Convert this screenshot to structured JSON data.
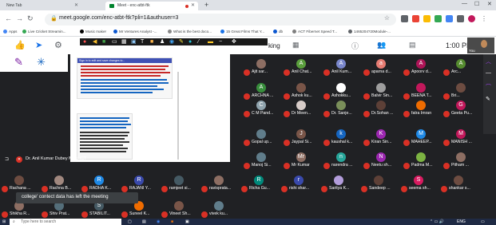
{
  "browser": {
    "tabs": [
      {
        "label": "New Tab",
        "active": false
      },
      {
        "label": "Meet - enc-atbt-ftk",
        "active": true
      }
    ],
    "url": "meet.google.com/enc-atbt-ftk?pli=1&authuser=3",
    "bookmarks": [
      {
        "label": "Apps",
        "color": "#4285f4"
      },
      {
        "label": "Live Cricket Streamin...",
        "color": "#34a853"
      },
      {
        "label": "Music maker",
        "color": "#000000"
      },
      {
        "label": "Mr Ventures Analyst -...",
        "color": "#0b57d0"
      },
      {
        "label": "What is the best doco...",
        "color": "#888888"
      },
      {
        "label": "15 Great Films That Y...",
        "color": "#1a73e8"
      },
      {
        "label": "db",
        "color": "#0b57d0"
      },
      {
        "label": "ACT Fibernet Speed T...",
        "color": "#7f7f7f"
      },
      {
        "label": "1465204?20Module-...",
        "color": "#5f6368"
      }
    ]
  },
  "meet": {
    "title_fragment": "king",
    "clock": "1:00 PM",
    "you_label": "You",
    "presenter": "Dr. Anil Kumar Dubey Multi-ICT",
    "notification": "college' contect data has left the meeting",
    "share": {
      "header": "Sign in to edit and save changes to...",
      "colors": {
        "header": "#3f51b5",
        "text_red": "#c62828",
        "text_blue": "#1565c0"
      }
    },
    "participants": [
      {
        "name": "Ajit sar...",
        "initial": "",
        "color": "#8d6e63"
      },
      {
        "name": "Anil Chat...",
        "initial": "A",
        "color": "#5a9e3c"
      },
      {
        "name": "Anil Kum...",
        "initial": "A",
        "color": "#7986cb"
      },
      {
        "name": "aparna d...",
        "initial": "a",
        "color": "#e67c73"
      },
      {
        "name": "Apoorv d...",
        "initial": "A",
        "color": "#ad1457"
      },
      {
        "name": "Arc...",
        "initial": "A",
        "color": "#558b2f"
      },
      {
        "name": "ARCHNA ...",
        "initial": "A",
        "color": "#388e3c"
      },
      {
        "name": "Ashok ku...",
        "initial": "",
        "color": "#795548"
      },
      {
        "name": "Ashokku...",
        "initial": "",
        "color": "#ffffff"
      },
      {
        "name": "Balvir Sin...",
        "initial": "",
        "color": "#9e9e9e"
      },
      {
        "name": "BEENA T...",
        "initial": "",
        "color": "#c2185b"
      },
      {
        "name": "Bri...",
        "initial": "",
        "color": "#6d4c41"
      },
      {
        "name": "C M Pand...",
        "initial": "C",
        "color": "#90a4ae"
      },
      {
        "name": "Dr Meen...",
        "initial": "",
        "color": "#d7ccc8"
      },
      {
        "name": "Dr. Sanje...",
        "initial": "",
        "color": "#7a8f5a"
      },
      {
        "name": "Dr.Sohan ...",
        "initial": "",
        "color": "#5d4037"
      },
      {
        "name": "fatra Imran",
        "initial": "",
        "color": "#ef6c00"
      },
      {
        "name": "Geeta Pu...",
        "initial": "G",
        "color": "#c2185b"
      },
      {
        "name": "Gopal up...",
        "initial": "",
        "color": "#607d8b"
      },
      {
        "name": "Jaypal Si...",
        "initial": "J",
        "color": "#795548"
      },
      {
        "name": "kaushal k...",
        "initial": "k",
        "color": "#1565c0"
      },
      {
        "name": "Kiran Sin...",
        "initial": "K",
        "color": "#9c27b0"
      },
      {
        "name": "MAHEEP...",
        "initial": "M",
        "color": "#1e88e5"
      },
      {
        "name": "MANISH ...",
        "initial": "M",
        "color": "#c2185b"
      },
      {
        "name": "Manoj Si...",
        "initial": "",
        "color": "#607d8b"
      },
      {
        "name": "Mr Kumar",
        "initial": "Mr",
        "color": "#8d6e63"
      },
      {
        "name": "narendra ...",
        "initial": "n",
        "color": "#26a69a"
      },
      {
        "name": "Neetu sh...",
        "initial": "N",
        "color": "#9c27b0"
      },
      {
        "name": "Padma M...",
        "initial": "",
        "color": "#7cb342"
      },
      {
        "name": "Pitham ...",
        "initial": "",
        "color": "#8d6e63"
      },
      {
        "name": "Rachana ...",
        "initial": "",
        "color": "#6d4c41"
      },
      {
        "name": "Rachna B...",
        "initial": "",
        "color": "#a1887f"
      },
      {
        "name": "RADHA K...",
        "initial": "R",
        "color": "#1e88e5"
      },
      {
        "name": "RAJANI Y...",
        "initial": "R",
        "color": "#3949ab"
      },
      {
        "name": "ramjeet si...",
        "initial": "",
        "color": "#455a64"
      },
      {
        "name": "ravisprata...",
        "initial": "",
        "color": "#8d6e63"
      },
      {
        "name": "Richa Gu...",
        "initial": "R",
        "color": "#00897b"
      },
      {
        "name": "rishi shar...",
        "initial": "r",
        "color": "#3949ab"
      },
      {
        "name": "Saritya K...",
        "initial": "",
        "color": "#b39ddb"
      },
      {
        "name": "Sandeep ...",
        "initial": "",
        "color": "#5d4037"
      },
      {
        "name": "seema sh...",
        "initial": "S",
        "color": "#d81b60"
      },
      {
        "name": "shankar s...",
        "initial": "",
        "color": "#6d4c41"
      },
      {
        "name": "Shikha R...",
        "initial": "",
        "color": "#8d6e63"
      },
      {
        "name": "Shiv Prat...",
        "initial": "",
        "color": "#546e7a"
      },
      {
        "name": "STABILIT...",
        "initial": "S",
        "color": "#455a64"
      },
      {
        "name": "Suneel K...",
        "initial": "",
        "color": "#ef6c00"
      },
      {
        "name": "Vineet Sh...",
        "initial": "",
        "color": "#795548"
      },
      {
        "name": "vivek ku...",
        "initial": "",
        "color": "#607d8b"
      }
    ]
  },
  "taskbar": {
    "search_placeholder": "Type here to search",
    "lang": "ENG"
  }
}
